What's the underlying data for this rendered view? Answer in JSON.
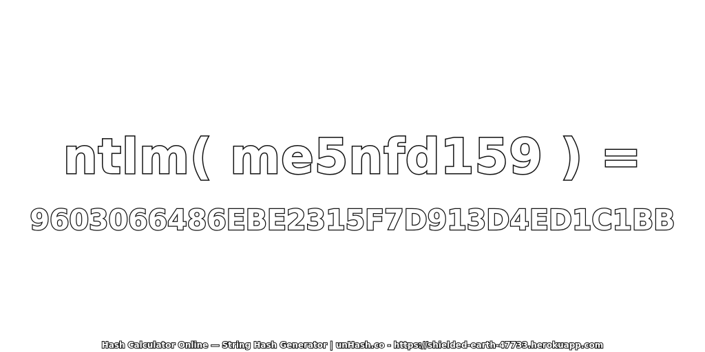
{
  "expression": "ntlm( me5nfd159 ) =",
  "hash": "9603066486EBE2315F7D913D4ED1C1BB",
  "footer": "Hash Calculator Online — String Hash Generator | unHash.co - https://shielded-earth-47733.herokuapp.com"
}
